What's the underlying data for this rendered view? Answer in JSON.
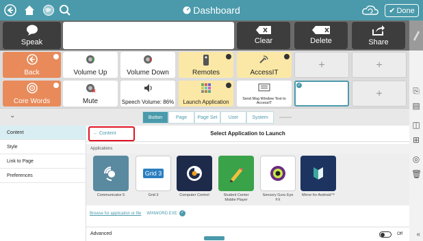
{
  "topbar": {
    "title": "Dashboard",
    "done_label": "Done",
    "icons": [
      "back-arrow-icon",
      "home-icon",
      "globe-icon",
      "search-icon",
      "cloud-sync-icon"
    ]
  },
  "message_bar": {
    "speak_label": "Speak",
    "clear_label": "Clear",
    "delete_label": "Delete",
    "share_label": "Share"
  },
  "grid": {
    "cells": [
      {
        "label": "Back",
        "color": "orange"
      },
      {
        "label": "Volume Up",
        "color": "white"
      },
      {
        "label": "Volume Down",
        "color": "white"
      },
      {
        "label": "Remotes",
        "color": "yellow"
      },
      {
        "label": "AccessIT",
        "color": "yellow"
      },
      {
        "label": "Core Words",
        "color": "orange"
      },
      {
        "label": "Mute",
        "color": "white"
      },
      {
        "label": "Speech Volume: 86%",
        "color": "white"
      },
      {
        "label": "Launch Application",
        "color": "yellow"
      },
      {
        "label": "Send Msg Window Text to AccessIT",
        "color": "white"
      }
    ]
  },
  "tabs": [
    {
      "label": "Button",
      "active": true
    },
    {
      "label": "Page",
      "active": false
    },
    {
      "label": "Page Set",
      "active": false
    },
    {
      "label": "User",
      "active": false
    },
    {
      "label": "System",
      "active": false
    }
  ],
  "leftnav": {
    "items": [
      "Content",
      "Style",
      "Link to Page",
      "Preferences"
    ]
  },
  "panel": {
    "back_label": "Content",
    "title": "Select Application to Launch",
    "section_label": "Applications",
    "apps": [
      {
        "name": "Communicator 5"
      },
      {
        "name": "Grid 3"
      },
      {
        "name": "Computer Control"
      },
      {
        "name": "Student Center Mobile Player"
      },
      {
        "name": "Sensory Guru Eye FX"
      },
      {
        "name": "Mirror for Android™"
      }
    ],
    "grid3_tile_text": "Grid 3",
    "browse_label": "Browse for application or file",
    "selected_file": "WINWORD.EXE",
    "advanced_label": "Advanced",
    "toggle_state": "Off"
  },
  "colors": {
    "accent": "#4a9aab",
    "orange": "#e88a5a",
    "yellow": "#fbe8a6",
    "highlight_box": "#e01020"
  }
}
